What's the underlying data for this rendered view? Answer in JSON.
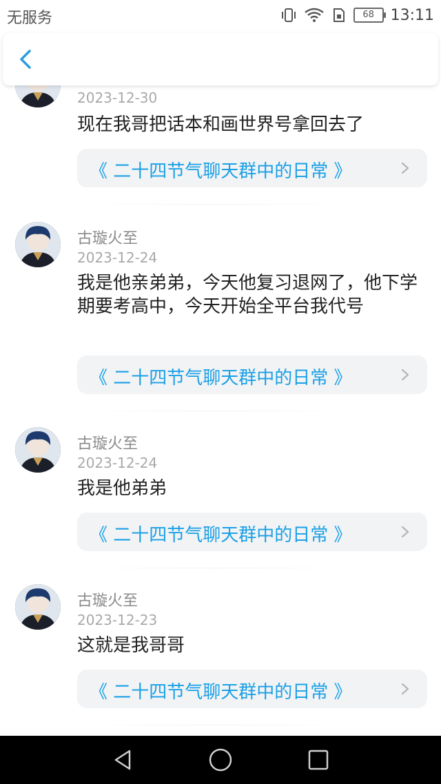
{
  "status_bar": {
    "carrier": "无服务",
    "battery": "68",
    "time": "13:11"
  },
  "header": {
    "back_icon": "chevron-left-icon"
  },
  "accent_color": "#1aa0e6",
  "posts": [
    {
      "username": "",
      "date": "2023-12-30",
      "message": "现在我哥把话本和画世界号拿回去了",
      "link": "《 二十四节气聊天群中的日常 》"
    },
    {
      "username": "古璇火至",
      "date": "2023-12-24",
      "message": "我是他亲弟弟，今天他复习退网了，他下学期要考高中，今天开始全平台我代号",
      "link": "《 二十四节气聊天群中的日常 》"
    },
    {
      "username": "古璇火至",
      "date": "2023-12-24",
      "message": "我是他弟弟",
      "link": "《 二十四节气聊天群中的日常 》"
    },
    {
      "username": "古璇火至",
      "date": "2023-12-23",
      "message": "这就是我哥哥",
      "link": "《 二十四节气聊天群中的日常 》"
    }
  ],
  "nav_bar": {
    "back_icon": "triangle-back-icon",
    "home_icon": "circle-home-icon",
    "recents_icon": "square-recents-icon"
  }
}
